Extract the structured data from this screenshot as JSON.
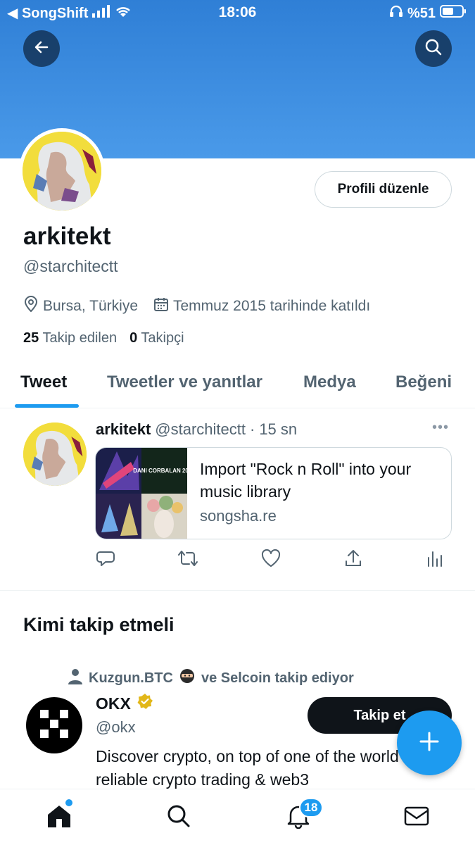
{
  "status_bar": {
    "carrier": "◀ SongShift",
    "time": "18:06",
    "battery": "%51"
  },
  "profile": {
    "edit_button": "Profili düzenle",
    "name": "arkitekt",
    "handle": "@starchitectt",
    "location": "Bursa, Türkiye",
    "joined": "Temmuz 2015 tarihinde katıldı",
    "following_count": "25",
    "following_label": "Takip edilen",
    "followers_count": "0",
    "followers_label": "Takipçi"
  },
  "tabs": [
    {
      "label": "Tweet",
      "active": true
    },
    {
      "label": "Tweetler ve yanıtlar",
      "active": false
    },
    {
      "label": "Medya",
      "active": false
    },
    {
      "label": "Beğeni",
      "active": false
    }
  ],
  "tweet": {
    "name": "arkitekt",
    "handle": "@starchitectt",
    "separator": "·",
    "time": "15 sn",
    "more": "•••",
    "card_title": "Import \"Rock n Roll\" into your music library",
    "card_domain": "songsha.re",
    "thumb_text": "DANI CORBALAN 2019"
  },
  "who_to_follow": {
    "title": "Kimi takip etmeli",
    "social_user": "Kuzgun.BTC",
    "social_rest": "ve Selcoin takip ediyor",
    "account_name": "OKX",
    "account_handle": "@okx",
    "follow_button": "Takip et",
    "bio": "Discover crypto, on top of one of the world's most reliable crypto trading & web3"
  },
  "bottom_nav": {
    "notification_count": "18"
  },
  "colors": {
    "accent": "#1d9bf0",
    "banner": "#3b8be0",
    "secondary_text": "#536471"
  }
}
